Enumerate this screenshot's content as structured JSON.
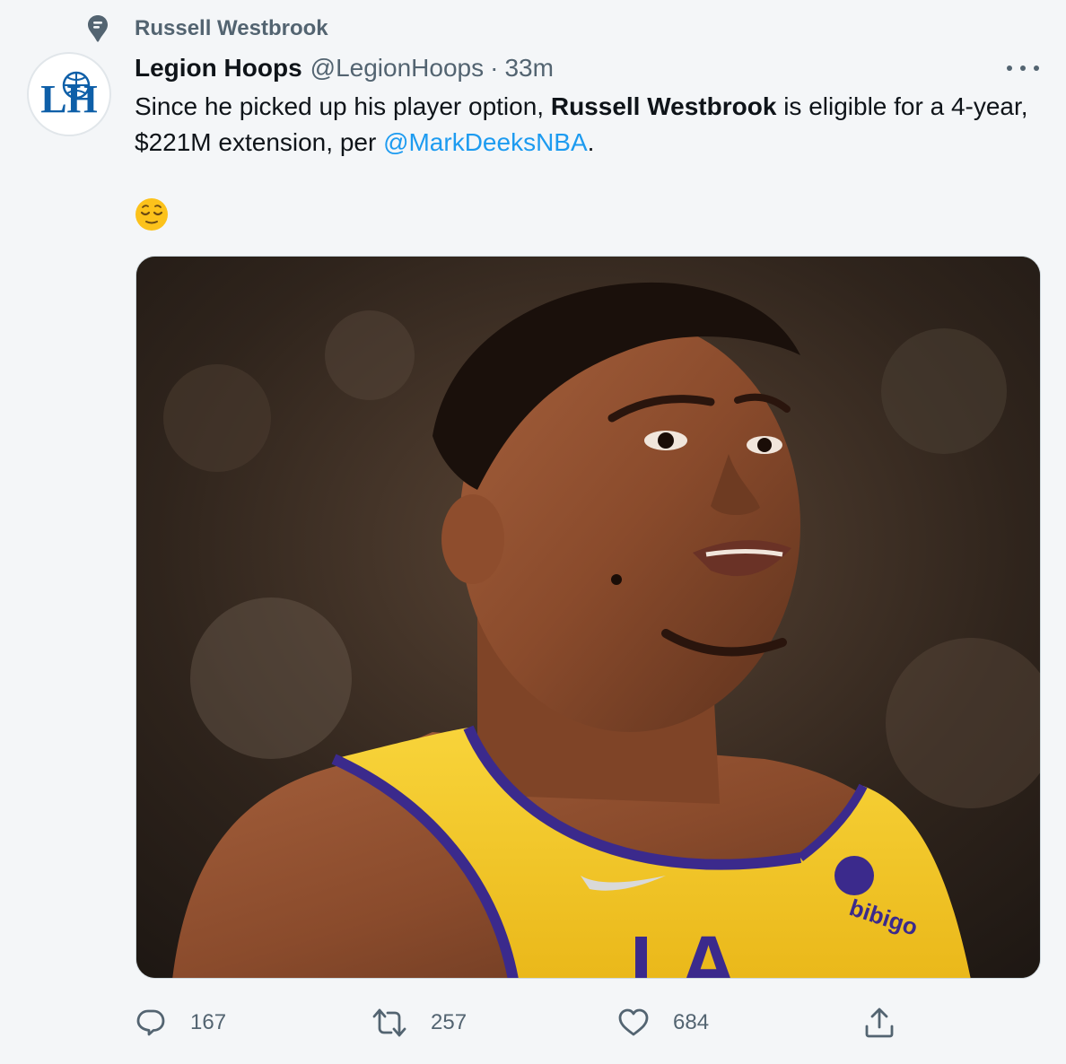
{
  "context": {
    "icon": "topic-icon",
    "label": "Russell Westbrook"
  },
  "tweet": {
    "avatar_icon": "legion-hoops-logo-icon",
    "avatar_text": "LH",
    "display_name": "Legion Hoops",
    "handle": "@LegionHoops",
    "separator": "·",
    "time": "33m",
    "more_icon": "more-icon",
    "text": {
      "part1": "Since he picked up his player option, ",
      "bold": "Russell Westbrook",
      "part2": " is eligible for a 4-year, $221M extension, per ",
      "mention": "@MarkDeeksNBA",
      "part3": "."
    },
    "emoji": "😌",
    "media": {
      "type": "photo",
      "jersey_sponsor": "bibigo",
      "jersey_letters": "LA"
    }
  },
  "actions": {
    "reply": {
      "icon": "reply-icon",
      "count": "167"
    },
    "retweet": {
      "icon": "retweet-icon",
      "count": "257"
    },
    "like": {
      "icon": "heart-icon",
      "count": "684"
    },
    "share": {
      "icon": "share-icon"
    }
  },
  "colors": {
    "background": "#f4f6f8",
    "text": "#0f1419",
    "secondary": "#536471",
    "link": "#1d9bf0",
    "jersey_gold": "#f3c623",
    "jersey_purple": "#3b2a8c"
  }
}
